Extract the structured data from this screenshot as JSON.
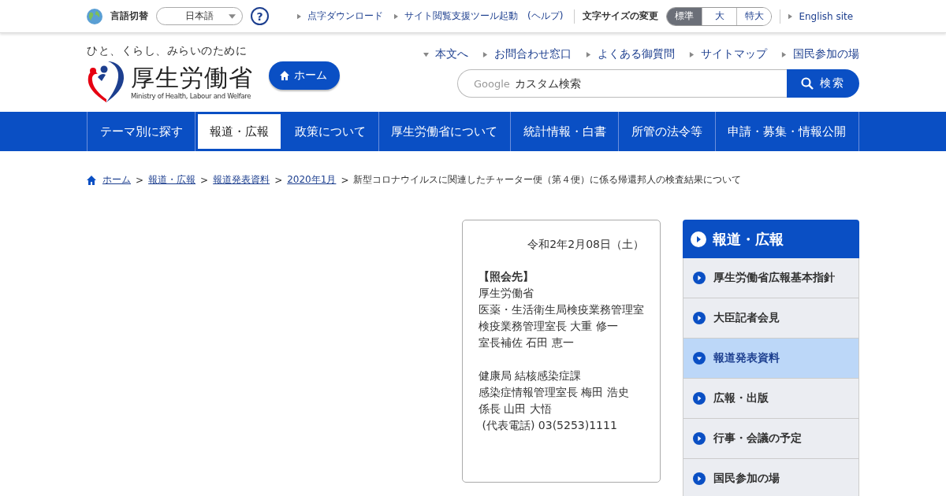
{
  "top_bar": {
    "language_label": "言語切替",
    "language_select": "日本語",
    "help": "?",
    "links": [
      {
        "label": "点字ダウンロード"
      },
      {
        "label": "サイト閲覧支援ツール起動　(ヘルプ)"
      }
    ],
    "font_size": {
      "label": "文字サイズの変更",
      "options": [
        {
          "label": "標準",
          "selected": true
        },
        {
          "label": "大",
          "selected": false
        },
        {
          "label": "特大",
          "selected": false
        }
      ]
    },
    "english_link": "English site"
  },
  "header": {
    "tagline": "ひと、くらし、みらいのために",
    "logo_title": "厚生労働省",
    "logo_subtitle": "Ministry of Health, Labour and Welfare",
    "home_button": "ホーム",
    "quick_links": [
      {
        "label": "本文へ",
        "kind": "down"
      },
      {
        "label": "お問合わせ窓口",
        "kind": "right"
      },
      {
        "label": "よくある御質問",
        "kind": "right"
      },
      {
        "label": "サイトマップ",
        "kind": "right"
      },
      {
        "label": "国民参加の場",
        "kind": "right"
      }
    ],
    "search": {
      "brand": "Google",
      "placeholder": "カスタム検索",
      "button": "検索"
    }
  },
  "nav": [
    {
      "label": "テーマ別に探す",
      "selected": false
    },
    {
      "label": "報道・広報",
      "selected": true
    },
    {
      "label": "政策について",
      "selected": false
    },
    {
      "label": "厚生労働省について",
      "selected": false
    },
    {
      "label": "統計情報・白書",
      "selected": false
    },
    {
      "label": "所管の法令等",
      "selected": false
    },
    {
      "label": "申請・募集・情報公開",
      "selected": false
    }
  ],
  "breadcrumb": [
    {
      "label": "ホーム",
      "kind": "link"
    },
    {
      "separator": ">",
      "label": "報道・広報",
      "kind": "link"
    },
    {
      "separator": ">",
      "label": "報道発表資料",
      "kind": "link"
    },
    {
      "separator": ">",
      "label": "2020年1月",
      "kind": "link"
    },
    {
      "separator": ">",
      "label": "新型コロナウイルスに関連したチャーター便（第４便）に係る帰還邦人の検査結果について",
      "kind": "current"
    }
  ],
  "contact_box": {
    "date": "令和2年2月08日（土）",
    "heading": "【照会先】",
    "blocks": [
      [
        "厚生労働省",
        "医薬・生活衛生局検疫業務管理室",
        "検疫業務管理室長 大重 修一",
        "室長補佐 石田 恵一"
      ],
      [
        "健康局 結核感染症課",
        "感染症情報管理室長 梅田 浩史",
        "係長 山田 大悟",
        " (代表電話) 03(5253)1111"
      ]
    ]
  },
  "side_menu": {
    "title": "報道・広報",
    "items": [
      {
        "label": "厚生労働省広報基本指針",
        "selected": false
      },
      {
        "label": "大臣記者会見",
        "selected": false
      },
      {
        "label": "報道発表資料",
        "selected": true
      },
      {
        "label": "広報・出版",
        "selected": false
      },
      {
        "label": "行事・会議の予定",
        "selected": false
      },
      {
        "label": "国民参加の場",
        "selected": false
      }
    ]
  }
}
